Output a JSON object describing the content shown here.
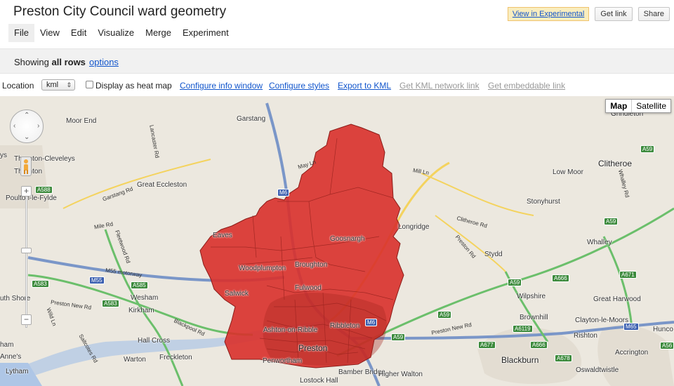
{
  "header": {
    "title": "Preston City Council ward geometry",
    "view_experimental": "View in Experimental",
    "get_link": "Get link",
    "share": "Share"
  },
  "menu": [
    "File",
    "View",
    "Edit",
    "Visualize",
    "Merge",
    "Experiment"
  ],
  "rows_bar": {
    "showing": "Showing",
    "all_rows": "all rows",
    "options": "options"
  },
  "toolbar": {
    "location_label": "Location",
    "location_value": "kml",
    "heatmap_label": "Display as heat map",
    "configure_info": "Configure info window",
    "configure_styles": "Configure styles",
    "export_kml": "Export to KML",
    "kml_network": "Get KML network link",
    "embeddable": "Get embeddable link"
  },
  "map": {
    "type_map": "Map",
    "type_satellite": "Satellite",
    "zoom_in": "+",
    "zoom_out": "−",
    "places": {
      "garstang": "Garstang",
      "moor_end": "Moor End",
      "thornton_cleveleys": "Thornton-Cleveleys",
      "thornton": "Thornton",
      "great_eccleston": "Great Eccleston",
      "poulton": "Poulton-le-Fylde",
      "eaves": "Eaves",
      "woodplumpton": "Woodplumpton",
      "broughton": "Broughton",
      "goosnargh": "Goosnargh",
      "fulwood": "Fulwood",
      "ashton": "Ashton-on-Ribble",
      "ribbleton": "Ribbleton",
      "preston": "Preston",
      "penwortham": "Penwortham",
      "salwick": "Salwick",
      "wesham": "Wesham",
      "kirkham": "Kirkham",
      "hall_cross": "Hall Cross",
      "warton": "Warton",
      "freckleton": "Freckleton",
      "lytham": "Lytham",
      "annes": "Anne's",
      "ham": "ham",
      "shore": "uth Shore",
      "bamber_bridge": "Bamber Bridge",
      "higher_walton": "Higher Walton",
      "lostock_hall": "Lostock Hall",
      "longridge": "Longridge",
      "stonyhurst": "Stonyhurst",
      "low_moor": "Low Moor",
      "clitheroe": "Clitheroe",
      "grindleton": "Grindleton",
      "whalley": "Whalley",
      "stydd": "Stydd",
      "wilpshire": "Wilpshire",
      "great_harwood": "Great Harwood",
      "brownhill": "Brownhill",
      "clayton": "Clayton-le-Moors",
      "rishton": "Rishton",
      "blackburn": "Blackburn",
      "oswaldtwistle": "Oswaldtwistle",
      "accrington": "Accrington",
      "hunco": "Hunco",
      "ys": "ys"
    },
    "roads": {
      "may_ln": "May Ln",
      "mill_ln": "Mill Ln",
      "garstang_rd": "Garstang Rd",
      "lancaster_rd": "Lancaster Rd",
      "mile_rd": "Mile Rd",
      "fleetwood_rd": "Fleetwood Rd",
      "m55_motorway": "M55 motorway",
      "preston_new_rd_w": "Preston New Rd",
      "preston_new_rd_e": "Preston New Rd",
      "blackpool_rd": "Blackpool Rd",
      "clitheroe_rd": "Clitheroe Rd",
      "preston_rd": "Preston Rd",
      "whalley_rd": "Whalley Rd",
      "wild_ln": "Wild Ln",
      "saltcotes_rd": "Saltcotes Rd"
    },
    "shields": {
      "a588": "A588",
      "m6_n": "M6",
      "m55": "M55",
      "a585": "A585",
      "a583_w": "A583",
      "a583": "A583",
      "m6_s": "M6",
      "a59_w": "A59",
      "a59_e": "A59",
      "a583_b": "A583",
      "a6119": "A6119",
      "a677": "A677",
      "a666": "A666",
      "a666_b": "A666",
      "a678": "A678",
      "m65": "M65",
      "a671": "A671",
      "a59_n": "A59",
      "a59_ne": "A59",
      "a56": "A56",
      "a666_n": "A666"
    }
  }
}
